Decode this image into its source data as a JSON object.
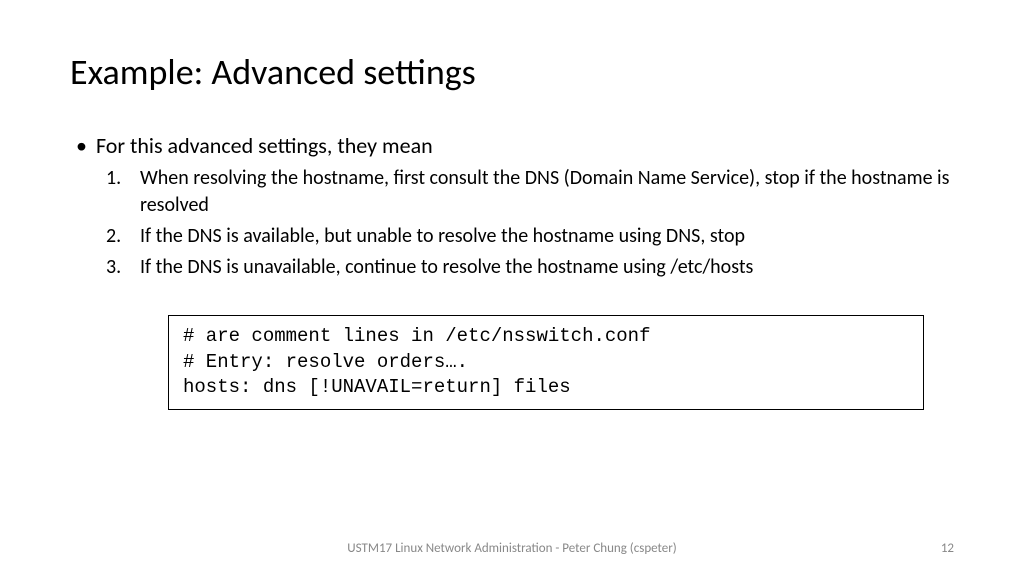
{
  "title": "Example: Advanced settings",
  "bullet_main": "For this advanced settings, they mean",
  "items": [
    {
      "num": "1.",
      "text": "When resolving the hostname, first consult the DNS  (Domain Name Service), stop if the hostname is resolved"
    },
    {
      "num": "2.",
      "text": "If the DNS is available, but unable to resolve the hostname using DNS, stop"
    },
    {
      "num": "3.",
      "text": "If the DNS is unavailable, continue to resolve the hostname using /etc/hosts"
    }
  ],
  "code": {
    "line1": "# are comment lines in /etc/nsswitch.conf",
    "line2": "# Entry:   resolve orders….",
    "line3": "hosts: dns [!UNAVAIL=return] files"
  },
  "footer_text": "USTM17 Linux Network Administration - Peter Chung (cspeter)",
  "page_number": "12"
}
